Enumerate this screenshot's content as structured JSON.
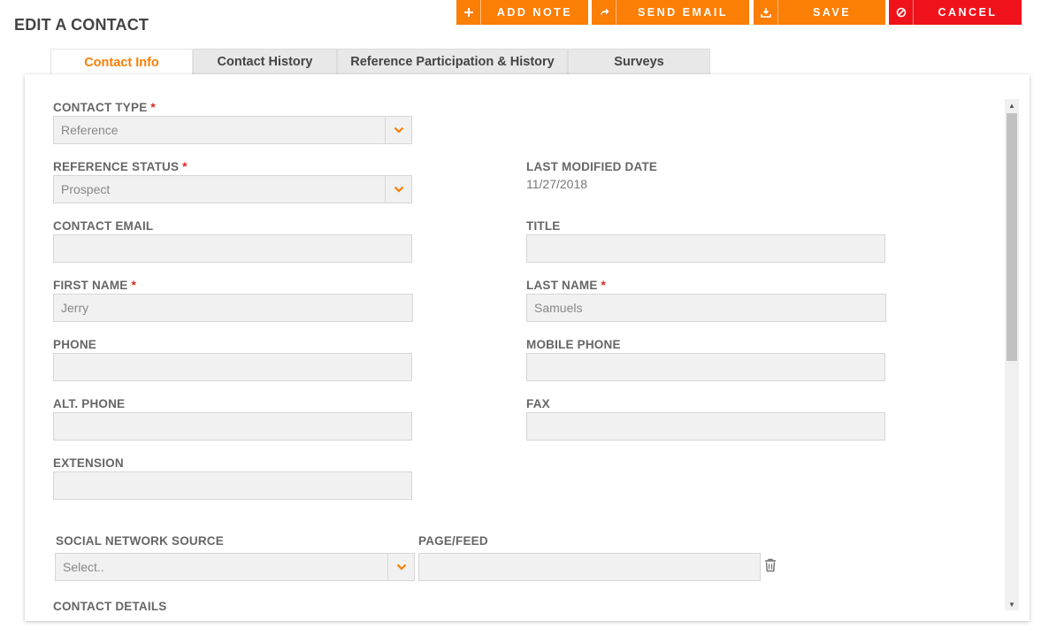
{
  "page": {
    "title": "EDIT A CONTACT"
  },
  "toolbar": {
    "add_note": {
      "label": "ADD NOTE",
      "icon": "plus-icon"
    },
    "send_email": {
      "label": "SEND EMAIL",
      "icon": "share-icon"
    },
    "save": {
      "label": "SAVE",
      "icon": "download-icon"
    },
    "cancel": {
      "label": "CANCEL",
      "icon": "cancel-icon"
    }
  },
  "tabs": [
    {
      "label": "Contact Info",
      "active": true
    },
    {
      "label": "Contact History",
      "active": false
    },
    {
      "label": "Reference Participation & History",
      "active": false
    },
    {
      "label": "Surveys",
      "active": false
    }
  ],
  "form": {
    "contact_type": {
      "label": "CONTACT TYPE",
      "value": "Reference",
      "required_mark": "*"
    },
    "reference_status": {
      "label": "REFERENCE STATUS",
      "value": "Prospect",
      "required_mark": "*"
    },
    "last_modified": {
      "label": "LAST MODIFIED DATE",
      "value": "11/27/2018"
    },
    "contact_email": {
      "label": "CONTACT EMAIL",
      "value": ""
    },
    "title": {
      "label": "TITLE",
      "value": ""
    },
    "first_name": {
      "label": "FIRST NAME",
      "value": "Jerry",
      "required_mark": "*"
    },
    "last_name": {
      "label": "LAST NAME",
      "value": "Samuels",
      "required_mark": "*"
    },
    "phone": {
      "label": "PHONE",
      "value": ""
    },
    "mobile_phone": {
      "label": "MOBILE PHONE",
      "value": ""
    },
    "alt_phone": {
      "label": "ALT. PHONE",
      "value": ""
    },
    "fax": {
      "label": "FAX",
      "value": ""
    },
    "extension": {
      "label": "EXTENSION",
      "value": ""
    },
    "social_network_source": {
      "label": "SOCIAL NETWORK SOURCE",
      "value": "Select.."
    },
    "page_feed": {
      "label": "PAGE/FEED",
      "value": ""
    },
    "contact_details": {
      "label": "CONTACT DETAILS"
    }
  },
  "colors": {
    "accent": "#fb7e05",
    "danger": "#f0121a",
    "required": "#e0261e"
  }
}
